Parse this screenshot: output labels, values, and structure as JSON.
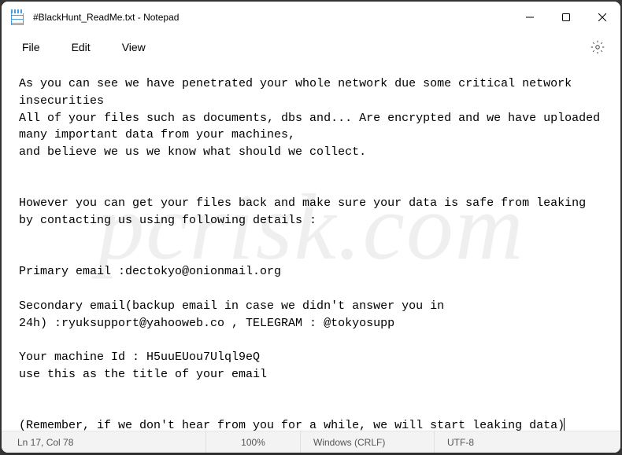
{
  "window": {
    "title": "#BlackHunt_ReadMe.txt - Notepad"
  },
  "menu": {
    "file": "File",
    "edit": "Edit",
    "view": "View"
  },
  "content": {
    "text": "As you can see we have penetrated your whole network due some critical network insecurities\nAll of your files such as documents, dbs and... Are encrypted and we have uploaded many important data from your machines,\nand believe we us we know what should we collect.\n\n\nHowever you can get your files back and make sure your data is safe from leaking by contacting us using following details :\n\n\nPrimary email :dectokyo@onionmail.org\n\nSecondary email(backup email in case we didn't answer you in\n24h) :ryuksupport@yahooweb.co , TELEGRAM : @tokyosupp\n\nYour machine Id : H5uuEUou7Ulql9eQ\nuse this as the title of your email\n\n\n(Remember, if we don't hear from you for a while, we will start leaking data)"
  },
  "status": {
    "position": "Ln 17, Col 78",
    "zoom": "100%",
    "eol": "Windows (CRLF)",
    "encoding": "UTF-8"
  },
  "watermark": "pcrisk.com"
}
